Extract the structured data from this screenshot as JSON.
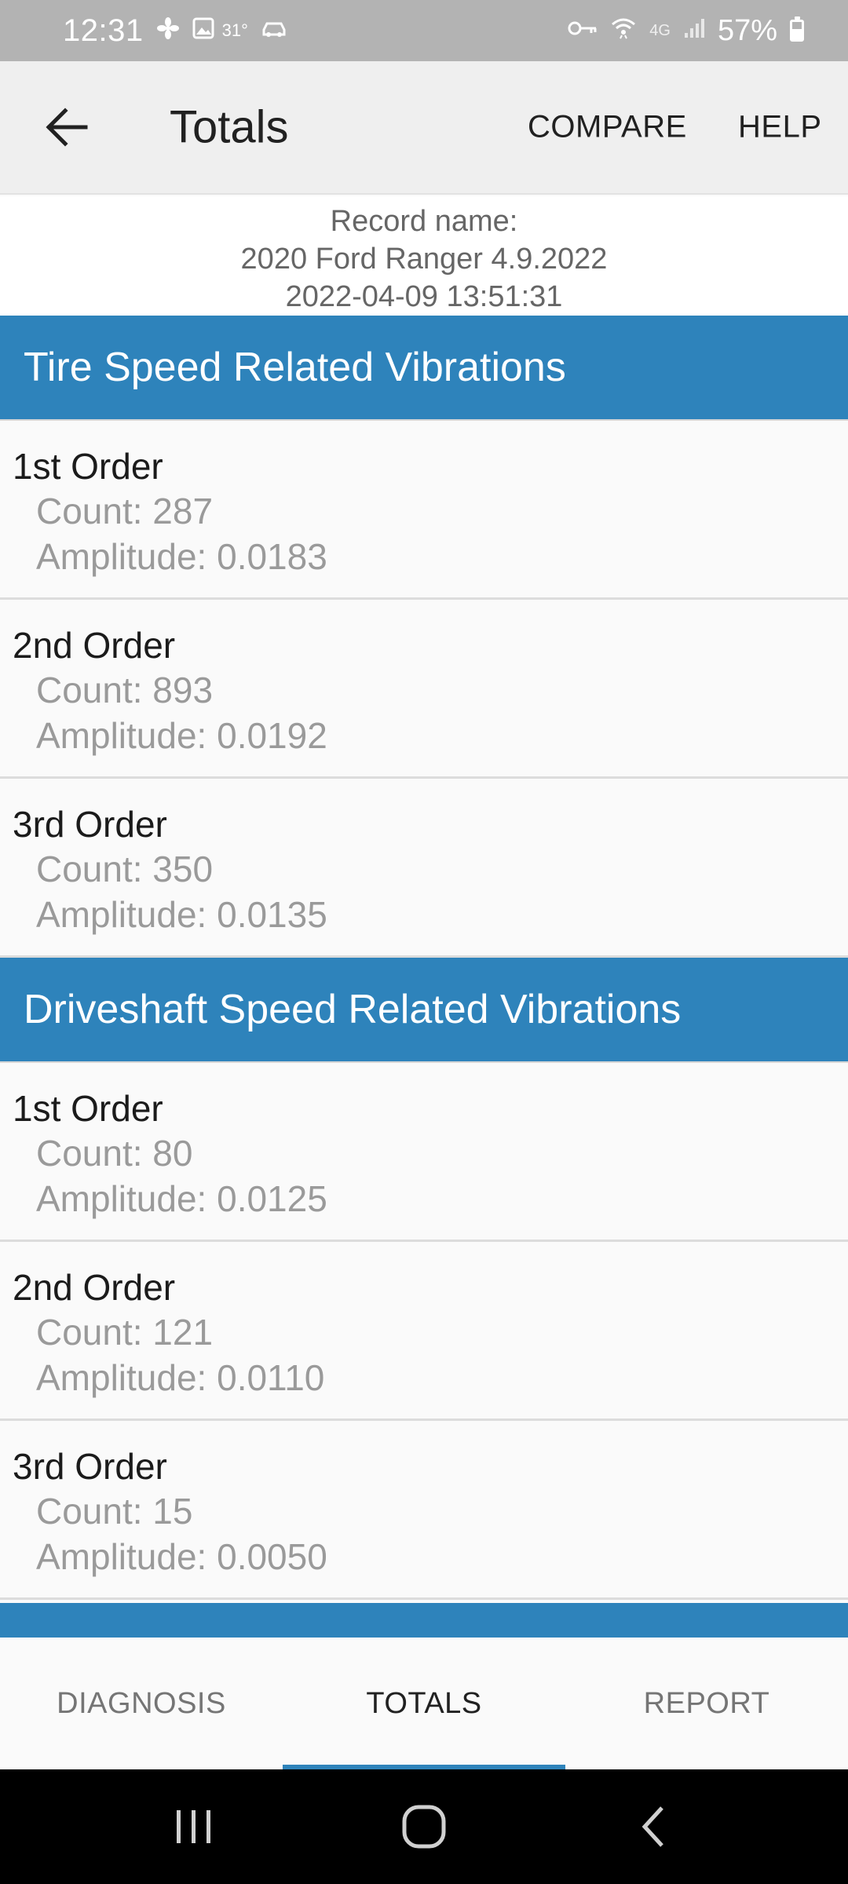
{
  "status_bar": {
    "time": "12:31",
    "temperature": "31°",
    "network": "4G",
    "battery_percent": "57%",
    "battery_level": 0.57,
    "icons": [
      "fan-icon",
      "image-icon",
      "car-icon",
      "vpn-key-icon",
      "wifi-icon",
      "signal-icon",
      "battery-icon"
    ]
  },
  "app_bar": {
    "title": "Totals",
    "compare_label": "COMPARE",
    "help_label": "HELP"
  },
  "record": {
    "label": "Record name:",
    "name": "2020 Ford Ranger 4.9.2022",
    "timestamp": "2022-04-09 13:51:31"
  },
  "sections": [
    {
      "title": "Tire Speed Related Vibrations",
      "orders": [
        {
          "title": "1st Order",
          "count": "Count: 287",
          "amplitude": "Amplitude: 0.0183"
        },
        {
          "title": "2nd Order",
          "count": "Count: 893",
          "amplitude": "Amplitude: 0.0192"
        },
        {
          "title": "3rd Order",
          "count": "Count: 350",
          "amplitude": "Amplitude: 0.0135"
        }
      ]
    },
    {
      "title": "Driveshaft Speed Related Vibrations",
      "orders": [
        {
          "title": "1st Order",
          "count": "Count: 80",
          "amplitude": "Amplitude: 0.0125"
        },
        {
          "title": "2nd Order",
          "count": "Count: 121",
          "amplitude": "Amplitude: 0.0110"
        },
        {
          "title": "3rd Order",
          "count": "Count: 15",
          "amplitude": "Amplitude: 0.0050"
        }
      ]
    }
  ],
  "tabs": [
    {
      "label": "DIAGNOSIS",
      "active": false
    },
    {
      "label": "TOTALS",
      "active": true
    },
    {
      "label": "REPORT",
      "active": false
    }
  ],
  "colors": {
    "accent": "#2e83bb",
    "status_bar": "#b3b3b3",
    "app_bar": "#efefef"
  }
}
